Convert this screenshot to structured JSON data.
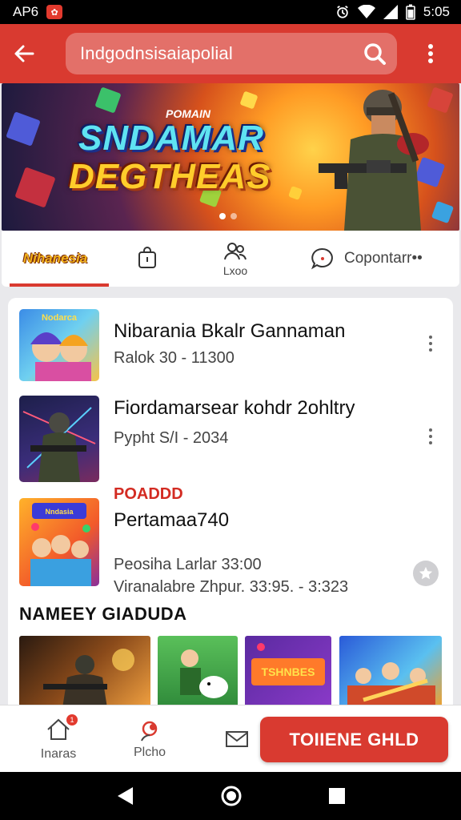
{
  "status_bar": {
    "carrier": "AP6",
    "time": "5:05"
  },
  "search": {
    "query": "Indgodnsisaiapolial"
  },
  "banner": {
    "small_title": "POMAIN",
    "title_line1": "SNDAMAR",
    "title_line2": "DEGTHEAS",
    "slide_count": 2,
    "active_slide": 1
  },
  "tabs": [
    {
      "label": "Nihanesia"
    },
    {
      "label": ""
    },
    {
      "label": "Lxoo"
    },
    {
      "label": "Copontarr••"
    }
  ],
  "list": [
    {
      "title": "Nibarania Bkalr Gannaman",
      "subtitle": "Ralok 30 - 11300"
    },
    {
      "title": "Fiordamarsear kohdr 2ohltry",
      "subtitle": "Pypht S/I - 2034"
    },
    {
      "tag": "POADDD",
      "title": "Pertamaa740",
      "subtitle": "Peosiha Larlar 33:00",
      "detail": "Viranalabre Zhpur. 33:95. - 3:323"
    }
  ],
  "section": {
    "title": "NAMEEY GIADUDA"
  },
  "bottom_nav": {
    "home_label": "Inaras",
    "home_badge": "1",
    "profile_label": "Plcho",
    "cta_label": "TOIIENE GHLD"
  },
  "colors": {
    "primary": "#d93a30",
    "accent_yellow": "#ffcd2b",
    "accent_cyan": "#5fe3f2"
  }
}
